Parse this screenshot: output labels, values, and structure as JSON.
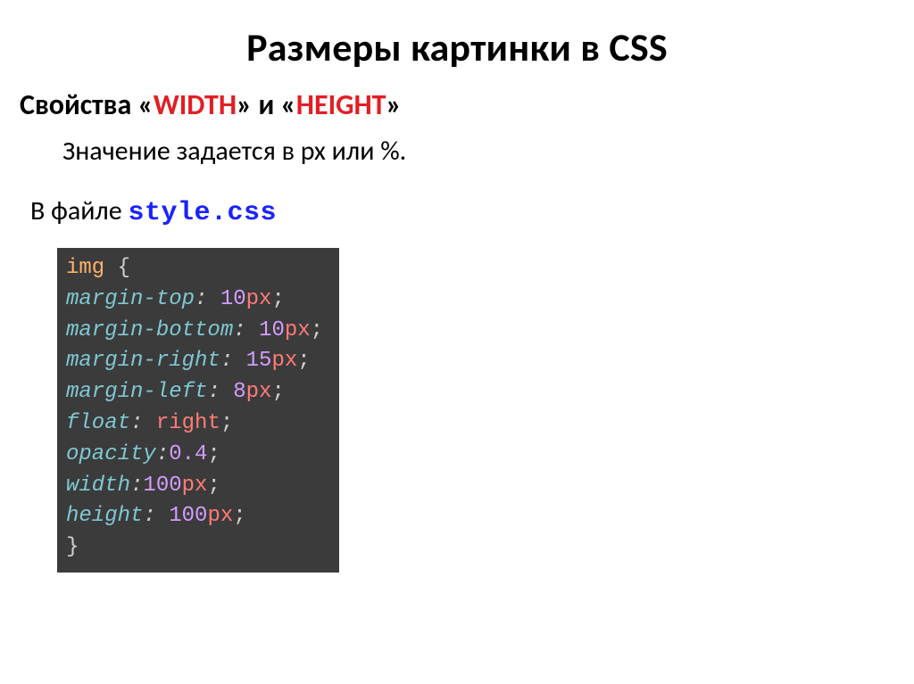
{
  "title": "Размеры картинки в CSS",
  "subtitle": {
    "pre": "Свойства «",
    "kw1": "WIDTH",
    "mid": "» и «",
    "kw2": "HEIGHT",
    "post": "»"
  },
  "desc": "Значение задается в px или %.",
  "file_line": {
    "pre": "В файле ",
    "file": "style.css"
  },
  "code": {
    "l1_sel": "img",
    "l1_brace": " {",
    "l2_prop": "margin-top",
    "l2_num": "10",
    "l2_unit": "px",
    "l3_prop": "margin-bottom",
    "l3_num": "10",
    "l3_unit": "px",
    "l4_prop": "margin-right",
    "l4_num": "15",
    "l4_unit": "px",
    "l5_prop": "margin-left",
    "l5_num": "8",
    "l5_unit": "px",
    "l6_prop": "float",
    "l6_val": "right",
    "l7_prop": "opacity",
    "l7_num": "0.4",
    "l8_prop": "width",
    "l8_num": "100",
    "l8_unit": "px",
    "l9_prop": "height",
    "l9_num": "100",
    "l9_unit": "px",
    "colon": ":",
    "semi": ";",
    "space": " ",
    "close": "}"
  }
}
